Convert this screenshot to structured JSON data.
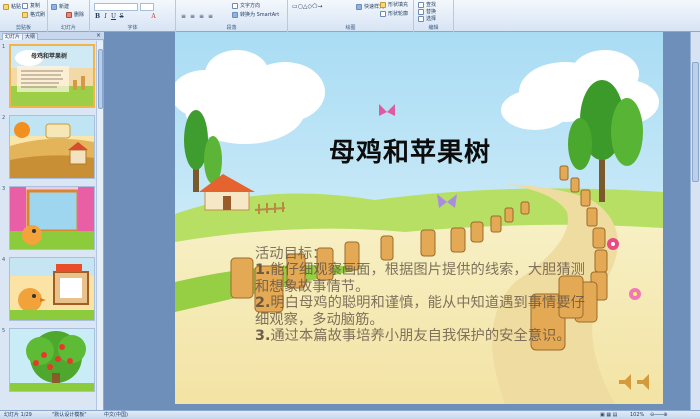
{
  "ribbon": {
    "clipboard": {
      "paste": "粘贴",
      "copy": "复制",
      "format_painter": "格式刷",
      "group": "剪贴板"
    },
    "slides": {
      "new_slide": "新建",
      "delete": "删除",
      "group": "幻灯片"
    },
    "font": {
      "group": "字体"
    },
    "paragraph": {
      "group": "段落",
      "text_direction": "文字方向",
      "convert_smartart": "转换为 SmartArt"
    },
    "drawing": {
      "group": "绘图",
      "quick_styles": "快速样式",
      "shape_fill": "形状填充",
      "shape_outline": "形状轮廓"
    },
    "editing": {
      "group": "编辑",
      "find": "查找",
      "replace": "替换",
      "select": "选择"
    }
  },
  "panel": {
    "tabs": {
      "slides": "幻灯片",
      "outline": "大纲"
    },
    "close": "×",
    "numbers": [
      "1",
      "2",
      "3",
      "4",
      "5"
    ],
    "thumb1_title": "母鸡和苹果树"
  },
  "slide": {
    "title": "母鸡和苹果树",
    "goals_heading": "活动目标：",
    "goals": [
      {
        "num": "1.",
        "text": "能仔细观察画面，根据图片提供的线索，大胆猜测和想象故事情节。"
      },
      {
        "num": "2.",
        "text": "明白母鸡的聪明和谨慎，能从中知道遇到事情要仔细观察，多动脑筋。"
      },
      {
        "num": "3.",
        "text": "通过本篇故事培养小朋友自我保护的安全意识。"
      }
    ]
  },
  "status": {
    "slide_counter": "幻灯片 1/29",
    "theme": "\"默认设计模板\"",
    "language": "中文(中国)",
    "zoom": "102%"
  },
  "colors": {
    "sky": "#bfe6f7",
    "grass": "#8fcc3a",
    "road": "#efdca0",
    "wood": "#e0a74a",
    "ribbon": "#dbe6f4"
  }
}
